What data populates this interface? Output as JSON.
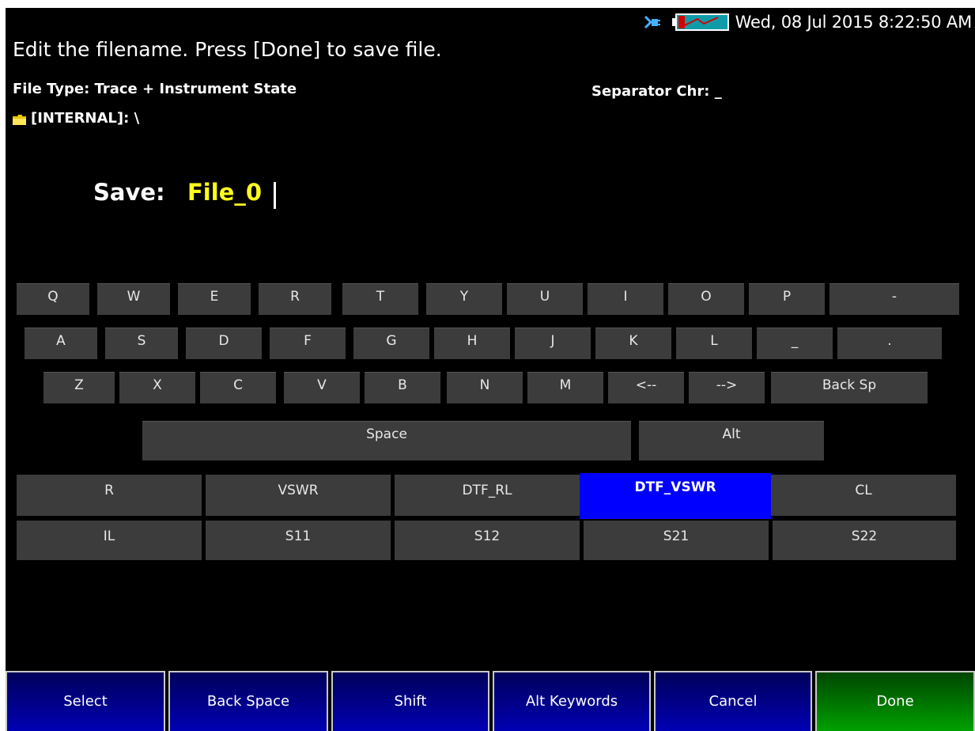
{
  "status": {
    "datetime": "Wed, 08 Jul 2015 8:22:50 AM",
    "icons": [
      "usb-plug-icon",
      "battery-icon"
    ]
  },
  "header": {
    "instruction": "Edit the filename.  Press [Done] to save file.",
    "file_type": "File Type: Trace + Instrument State",
    "separator": "Separator Chr: _",
    "path": "[INTERNAL]: \\"
  },
  "save": {
    "label": "Save:",
    "value": "File_0"
  },
  "keyboard": {
    "row1": [
      "Q",
      "W",
      "E",
      "R",
      "T",
      "Y",
      "U",
      "I",
      "O",
      "P",
      "-"
    ],
    "row2": [
      "A",
      "S",
      "D",
      "F",
      "G",
      "H",
      "J",
      "K",
      "L",
      "_",
      "."
    ],
    "row3": [
      "Z",
      "X",
      "C",
      "V",
      "B",
      "N",
      "M",
      "<--",
      "-->",
      "Back Sp"
    ],
    "row4": [
      "Space",
      "Alt"
    ]
  },
  "keywords": {
    "row1": [
      "R",
      "VSWR",
      "DTF_RL",
      "DTF_VSWR",
      "CL"
    ],
    "row2": [
      "IL",
      "S11",
      "S12",
      "S21",
      "S22"
    ],
    "selected": "DTF_VSWR",
    "selected_color": "#0000ff"
  },
  "softkeys": [
    "Select",
    "Back Space",
    "Shift",
    "Alt Keywords",
    "Cancel",
    "Done"
  ],
  "colors": {
    "background": "#000000",
    "filename": "#ffff1e",
    "key": "#3c3c3c",
    "softkey": "#0000b4",
    "done": "#00a000"
  }
}
